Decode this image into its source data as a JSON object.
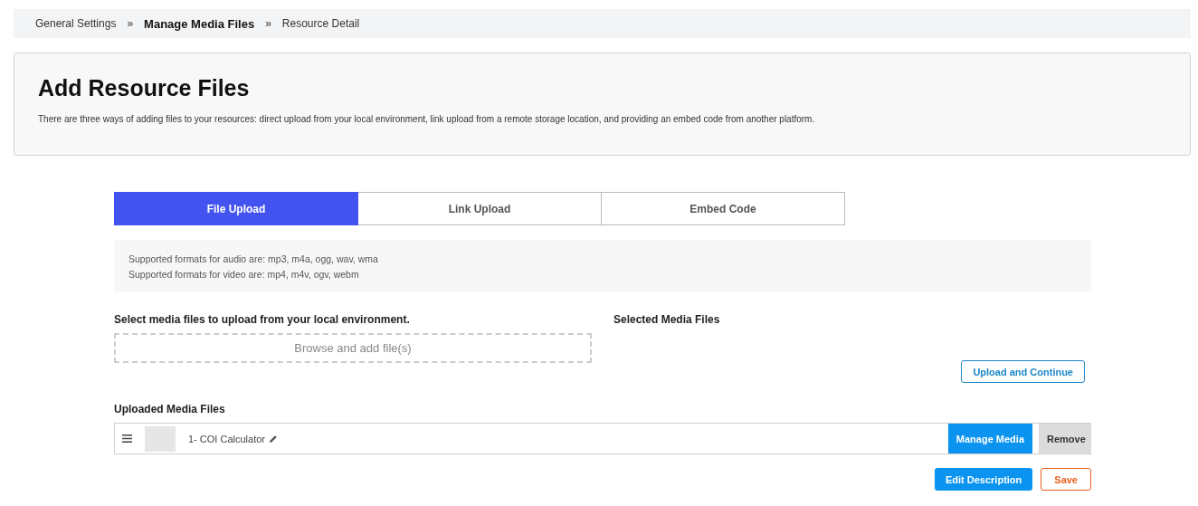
{
  "breadcrumb": [
    {
      "label": "General Settings",
      "current": false
    },
    {
      "label": "Manage Media Files",
      "current": true
    },
    {
      "label": "Resource Detail",
      "current": false
    }
  ],
  "breadcrumb_separator": "»",
  "header": {
    "title": "Add Resource Files",
    "description": "There are three ways of adding files to your resources: direct upload from your local environment, link upload from a remote storage location, and providing an embed code from another platform."
  },
  "tabs": [
    {
      "label": "File Upload",
      "selected": true
    },
    {
      "label": "Link Upload",
      "selected": false
    },
    {
      "label": "Embed Code",
      "selected": false
    }
  ],
  "formats": [
    "Supported formats for audio are: mp3, m4a, ogg, wav, wma",
    "Supported formats for video are: mp4, m4v, ogv, webm"
  ],
  "select_label": "Select media files to upload from your local environment.",
  "browse_label": "Browse and add file(s)",
  "selected_label": "Selected Media Files",
  "upload_button": "Upload and Continue",
  "uploaded_label": "Uploaded Media Files",
  "uploaded_files": [
    {
      "name": "1- COI Calculator",
      "manage": "Manage Media",
      "remove": "Remove"
    }
  ],
  "edit_button": "Edit Description",
  "save_button": "Save"
}
